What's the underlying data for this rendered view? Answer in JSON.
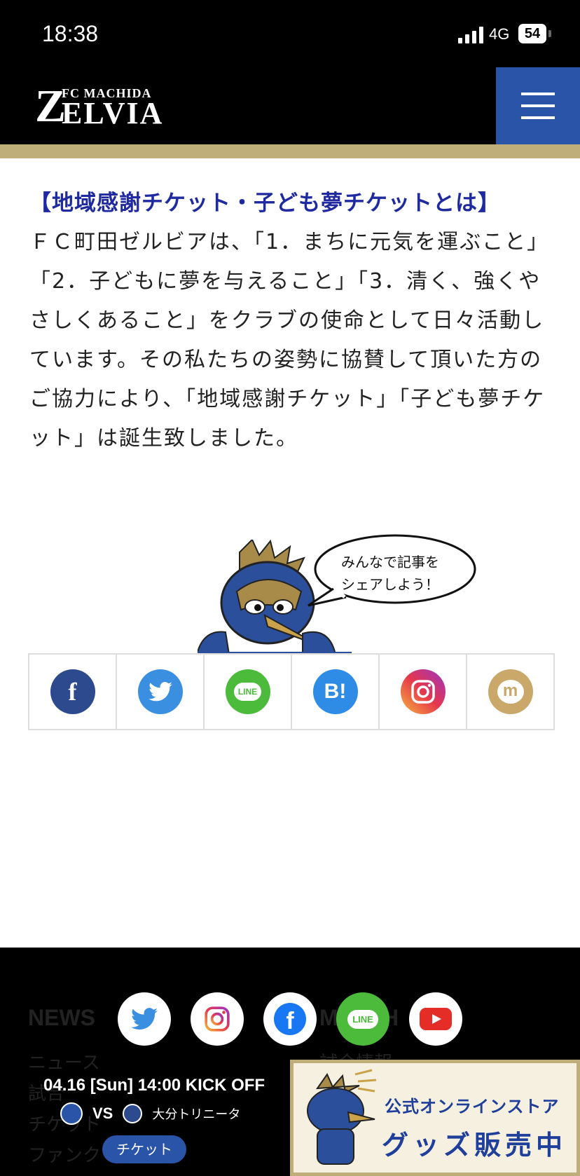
{
  "status_bar": {
    "time": "18:38",
    "network": "4G",
    "battery": "54"
  },
  "header": {
    "logo_sub": "FC MACHIDA",
    "logo_main": "ELVIA",
    "logo_z": "Z"
  },
  "article": {
    "heading": "【地域感謝チケット・子ども夢チケットとは】",
    "body": "ＦＣ町田ゼルビアは、「1．まちに元気を運ぶこと」「2．子どもに夢を与えること」「3．清く、強くやさしくあること」をクラブの使命として日々活動しています。その私たちの姿勢に協賛して頂いた方のご協力により、「地域感謝チケット」「子ども夢チケット」は誕生致しました。"
  },
  "share": {
    "bubble_line1": "みんなで記事を",
    "bubble_line2": "シェアしよう！",
    "buttons": [
      {
        "icon": "facebook-icon",
        "label": "f",
        "color": "#2d4a8e"
      },
      {
        "icon": "twitter-icon",
        "label": "",
        "color": "#3b8fe0"
      },
      {
        "icon": "line-icon",
        "label": "LINE",
        "color": "#4cbb3c"
      },
      {
        "icon": "hatena-icon",
        "label": "B!",
        "color": "#2e8ce6"
      },
      {
        "icon": "instagram-icon",
        "label": "",
        "color": "#d6307c"
      },
      {
        "icon": "mixi-icon",
        "label": "m",
        "color": "#c9a86a"
      }
    ]
  },
  "footer": {
    "news_title": "NEWS",
    "news_items": [
      "ニュース",
      "試合",
      "チケット",
      "ファンク"
    ],
    "right_title": "MATCH",
    "right_item": "試合情報",
    "sns": [
      "twitter-icon",
      "instagram-icon",
      "facebook-icon",
      "line-icon",
      "youtube-icon"
    ],
    "match_date": "04.16 [Sun] 14:00 KICK OFF",
    "vs": "VS",
    "opponent": "大分トリニータ",
    "ticket_button": "チケット",
    "banner_line1": "公式オンラインストア",
    "banner_line2": "グッズ販売中"
  }
}
